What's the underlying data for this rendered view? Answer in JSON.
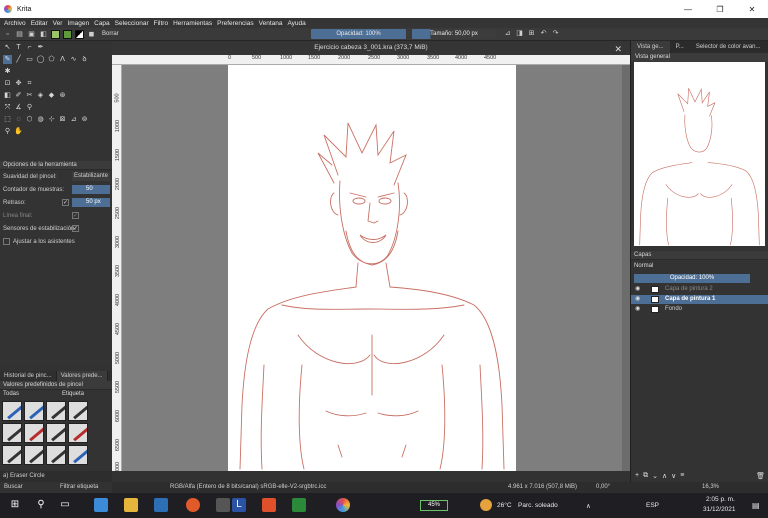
{
  "window": {
    "title": "Krita",
    "minimize": "—",
    "maximize": "❐",
    "close": "✕"
  },
  "menu": [
    "Archivo",
    "Editar",
    "Ver",
    "Imagen",
    "Capa",
    "Seleccionar",
    "Filtro",
    "Herramientas",
    "Preferencias",
    "Ventana",
    "Ayuda"
  ],
  "toolbar": {
    "brush_preset": "Borrar",
    "opacity": "Opacidad: 100%",
    "size": "Tamaño: 50,00 px"
  },
  "tool_options": {
    "header": "Opciones de la herramienta",
    "smoothing_label": "Suavidad del pincel:",
    "smoothing_value": "Estabilizante",
    "sample_count_label": "Contador de muestras:",
    "sample_count_value": "50",
    "delay_label": "Retraso:",
    "delay_value": "50",
    "delay_unit": "px",
    "finish_line_label": "Línea final:",
    "stabilize_sensors_label": "Sensores de estabilización:",
    "snap_assistants_label": "Ajustar a los asistentes"
  },
  "left_tabs": [
    "Historial de pinc...",
    "Valores prede..."
  ],
  "presets": {
    "header": "Valores predefinidos de pincel",
    "filter": "Todas",
    "tag": "Etiqueta"
  },
  "status_left": "a) Eraser Circle",
  "document": {
    "title": "Ejercicio cabeza 3_001.kra (373,7 MiB)",
    "ruler_h": [
      "0",
      "500",
      "1000",
      "1500",
      "2000",
      "2500",
      "3000",
      "3500",
      "4000",
      "4500"
    ],
    "ruler_v": [
      "500",
      "1000",
      "1500",
      "2000",
      "2500",
      "3000",
      "3500",
      "4000",
      "4500",
      "5000",
      "5500",
      "6000",
      "6500",
      "7000"
    ]
  },
  "right_dock": {
    "tabs": [
      "Vista ge...",
      "P...",
      "Selector de color avan..."
    ],
    "overview_header": "Vista general",
    "layers_header": "Capas",
    "blend_mode": "Normal",
    "layer_opacity": "Opacidad: 100%",
    "layers": [
      {
        "name": "Capa de pintura 2",
        "selected": false
      },
      {
        "name": "Capa de pintura 1",
        "selected": true
      },
      {
        "name": "Fondo",
        "selected": false
      }
    ]
  },
  "statusbar": {
    "filter_search": "Buscar",
    "filter_tag": "Filtrar etiqueta",
    "color_info": "RGB/Alfa (Entero de 8 bits/canal)  sRGB-elle-V2-srgbtrc.icc",
    "doc_size": "4.961 x 7.016 (507,8 MiB)",
    "rotation": "0,00°",
    "zoom": "16,3%"
  },
  "taskbar": {
    "battery": "45%",
    "weather_temp": "26°C",
    "weather_text": "Parc. soleado",
    "lang": "ESP",
    "time": "2:05 p. m.",
    "date": "31/12/2021"
  }
}
